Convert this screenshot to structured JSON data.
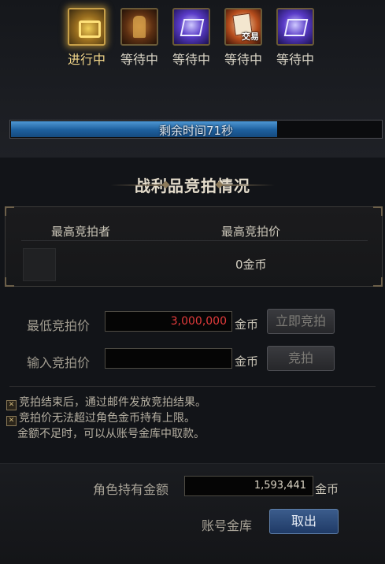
{
  "items": [
    {
      "status": "进行中",
      "icon": "gold-chest-icon"
    },
    {
      "status": "等待中",
      "icon": "armor-icon"
    },
    {
      "status": "等待中",
      "icon": "purple-box-icon"
    },
    {
      "status": "等待中",
      "icon": "trade-box-icon",
      "tag": "交易"
    },
    {
      "status": "等待中",
      "icon": "purple-box-icon"
    }
  ],
  "timer": {
    "text": "剩余时间71秒",
    "progress": 0.72
  },
  "section": {
    "title": "战利品竞拍情况"
  },
  "table": {
    "col_bidder": "最高竞拍者",
    "col_price": "最高竞拍价",
    "top_price": "0金币"
  },
  "min_bid": {
    "label": "最低竞拍价",
    "value": "3,000,000",
    "unit": "金币",
    "button": "立即竞拍"
  },
  "input_bid": {
    "label": "输入竞拍价",
    "value": "",
    "unit": "金币",
    "button": "竞拍"
  },
  "notices": [
    "竞拍结束后，通过邮件发放竞拍结果。",
    "竞拍价无法超过角色金币持有上限。",
    "金额不足时，可以从账号金库中取款。"
  ],
  "gold": {
    "label": "角色持有金额",
    "value": "1,593,441",
    "unit": "金币"
  },
  "vault": {
    "label": "账号金库",
    "button": "取出"
  },
  "colors": {
    "accent_gold": "#c8a048",
    "progress_blue": "#1d5f9e",
    "price_red": "#e23b3b",
    "button_blue": "#2d4d7d"
  }
}
